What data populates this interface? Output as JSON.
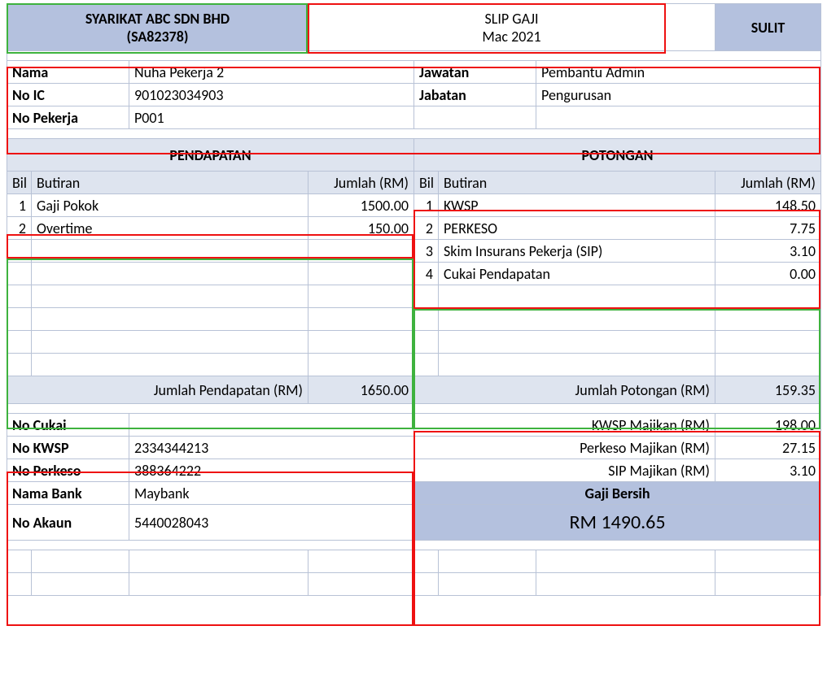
{
  "header": {
    "company_name": "SYARIKAT ABC SDN BHD",
    "company_reg": "(SA82378)",
    "slip_title": "SLIP GAJI",
    "period": "Mac 2021",
    "confidential": "SULIT"
  },
  "employee": {
    "labels": {
      "nama": "Nama",
      "no_ic": "No IC",
      "no_pekerja": "No Pekerja",
      "jawatan": "Jawatan",
      "jabatan": "Jabatan"
    },
    "nama": "Nuha Pekerja 2",
    "no_ic": "901023034903",
    "no_pekerja": "P001",
    "jawatan": "Pembantu Admin",
    "jabatan": "Pengurusan"
  },
  "section_headers": {
    "pendapatan": "PENDAPATAN",
    "potongan": "POTONGAN"
  },
  "col_headers": {
    "bil": "Bil",
    "butiran": "Butiran",
    "jumlah": "Jumlah (RM)"
  },
  "pendapatan": {
    "items": [
      {
        "bil": "1",
        "butiran": "Gaji Pokok",
        "jumlah": "1500.00"
      },
      {
        "bil": "2",
        "butiran": "Overtime",
        "jumlah": "150.00"
      }
    ],
    "total_label": "Jumlah Pendapatan (RM)",
    "total": "1650.00"
  },
  "potongan": {
    "items": [
      {
        "bil": "1",
        "butiran": "KWSP",
        "jumlah": "148.50"
      },
      {
        "bil": "2",
        "butiran": "PERKESO",
        "jumlah": "7.75"
      },
      {
        "bil": "3",
        "butiran": "Skim Insurans Pekerja (SIP)",
        "jumlah": "3.10"
      },
      {
        "bil": "4",
        "butiran": "Cukai Pendapatan",
        "jumlah": "0.00"
      }
    ],
    "total_label": "Jumlah Potongan (RM)",
    "total": "159.35"
  },
  "footer": {
    "labels": {
      "no_cukai": "No Cukai",
      "no_kwsp": "No KWSP",
      "no_perkeso": "No Perkeso",
      "nama_bank": "Nama Bank",
      "no_akaun": "No Akaun"
    },
    "no_cukai": "",
    "no_kwsp": "2334344213",
    "no_perkeso": "388364222",
    "nama_bank": "Maybank",
    "no_akaun": "5440028043",
    "employer": {
      "kwsp_label": "KWSP Majikan (RM)",
      "kwsp": "198.00",
      "perkeso_label": "Perkeso Majikan (RM)",
      "perkeso": "27.15",
      "sip_label": "SIP Majikan (RM)",
      "sip": "3.10"
    },
    "net_label": "Gaji Bersih",
    "net_amount": "RM 1490.65"
  }
}
